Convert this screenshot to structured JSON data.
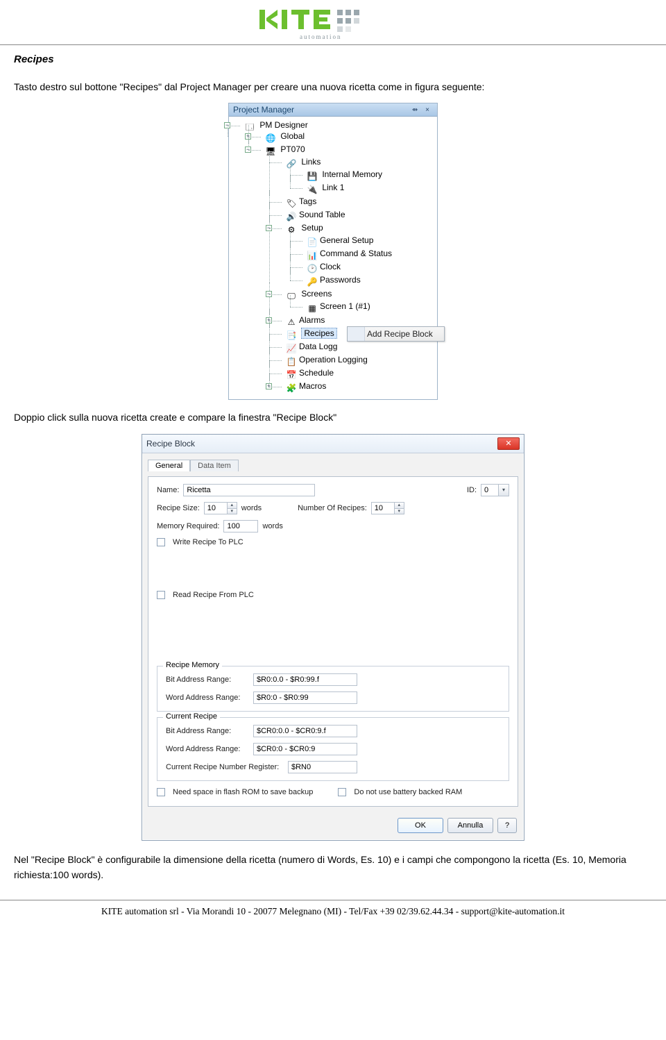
{
  "section_title": "Recipes",
  "para1": "Tasto destro sul bottone \"Recipes\" dal Project Manager per creare una nuova ricetta come in figura seguente:",
  "para2": "Doppio click sulla nuova ricetta create e compare la finestra \"Recipe Block\"",
  "para3": "Nel \"Recipe Block\" è configurabile la dimensione della ricetta (numero di Words, Es. 10) e i campi che compongono la ricetta (Es. 10, Memoria richiesta:100 words).",
  "footer": "KITE automation srl - Via Morandi 10 - 20077 Melegnano (MI) - Tel/Fax +39 02/39.62.44.34 - support@kite-automation.it",
  "pm": {
    "title": "Project Manager",
    "pin": "⇴",
    "close": "×",
    "root": "PM Designer",
    "items": {
      "global": "Global",
      "pt070": "PT070",
      "links": "Links",
      "internal_mem": "Internal Memory",
      "link1": "Link 1",
      "tags": "Tags",
      "sound": "Sound Table",
      "setup": "Setup",
      "general_setup": "General Setup",
      "command_status": "Command & Status",
      "clock": "Clock",
      "passwords": "Passwords",
      "screens": "Screens",
      "screen1": "Screen 1 (#1)",
      "alarms": "Alarms",
      "recipes": "Recipes",
      "data_log": "Data Logg",
      "op_log": "Operation Logging",
      "schedule": "Schedule",
      "macros": "Macros"
    },
    "ctx_item": "Add Recipe Block"
  },
  "dlg": {
    "title": "Recipe Block",
    "tabs": {
      "general": "General",
      "data_item": "Data Item"
    },
    "labels": {
      "name": "Name:",
      "id": "ID:",
      "recipe_size": "Recipe Size:",
      "words": "words",
      "num_recipes": "Number Of Recipes:",
      "mem_required": "Memory Required:",
      "write_plc": "Write Recipe To PLC",
      "read_plc": "Read Recipe From PLC",
      "recipe_mem": "Recipe Memory",
      "bit_addr": "Bit Address Range:",
      "word_addr": "Word Address Range:",
      "current_recipe": "Current Recipe",
      "cur_reg": "Current Recipe Number Register:",
      "need_space": "Need space in flash ROM to save backup",
      "no_battery": "Do not use battery backed RAM"
    },
    "values": {
      "name": "Ricetta",
      "id": "0",
      "recipe_size": "10",
      "num_recipes": "10",
      "mem_required": "100",
      "rm_bit": "$R0:0.0 - $R0:99.f",
      "rm_word": "$R0:0 - $R0:99",
      "cr_bit": "$CR0:0.0 - $CR0:9.f",
      "cr_word": "$CR0:0 - $CR0:9",
      "cur_reg": "$RN0"
    },
    "buttons": {
      "ok": "OK",
      "cancel": "Annulla",
      "help": "?"
    }
  }
}
